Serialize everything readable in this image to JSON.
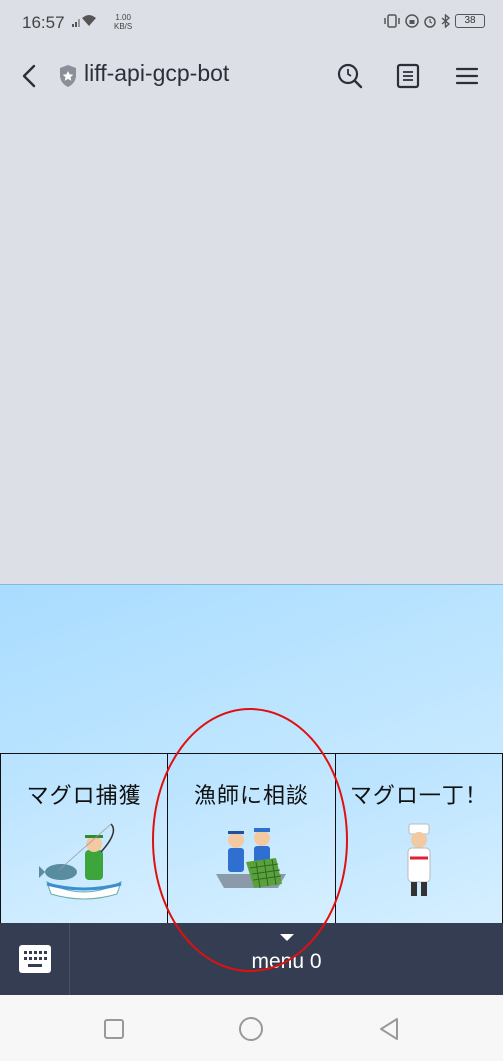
{
  "status_bar": {
    "time": "16:57",
    "speed_value": "1.00",
    "speed_unit": "KB/S",
    "battery": "38"
  },
  "header": {
    "title": "liff-api-gcp-bot"
  },
  "rich_menu": {
    "items": [
      {
        "label": "マグロ捕獲"
      },
      {
        "label": "漁師に相談"
      },
      {
        "label": "マグロ一丁！"
      }
    ]
  },
  "bottom_bar": {
    "menu_label": "menu 0"
  },
  "colors": {
    "header_bg": "#dcdfe6",
    "bottom_bar_bg": "#353d53",
    "annotation": "#e01010"
  }
}
